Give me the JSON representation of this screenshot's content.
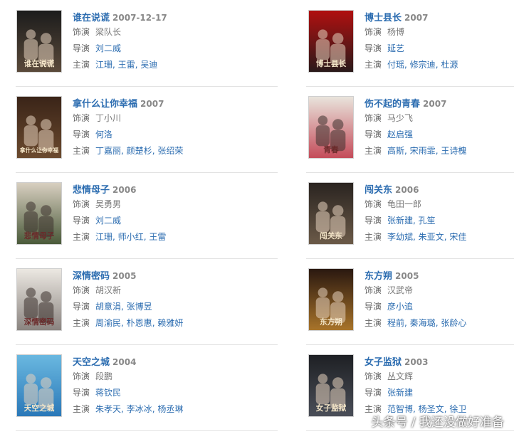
{
  "labels": {
    "role": "饰演",
    "director": "导演",
    "cast": "主演"
  },
  "movies": [
    {
      "title": "谁在说谎",
      "year": "2007-12-17",
      "role": "梁队长",
      "director": [
        "刘二威"
      ],
      "cast": [
        "江珊",
        "王雷",
        "吴迪"
      ],
      "poster_text": "谁在说谎",
      "colors": [
        "#1c1c1c",
        "#5a4a3a"
      ]
    },
    {
      "title": "博士县长",
      "year": "2007",
      "role": "杨博",
      "director": [
        "延艺"
      ],
      "cast": [
        "付瑶",
        "修宗迪",
        "杜源"
      ],
      "poster_text": "博士县长",
      "colors": [
        "#b01010",
        "#2a1a1a"
      ]
    },
    {
      "title": "拿什么让你幸福",
      "year": "2007",
      "role": "丁小川",
      "director": [
        "何洛"
      ],
      "cast": [
        "丁嘉丽",
        "颜楚杉",
        "张绍荣"
      ],
      "poster_text": "拿什么让你幸福",
      "colors": [
        "#3a2418",
        "#6b4a2e"
      ]
    },
    {
      "title": "伤不起的青春",
      "year": "2007",
      "role": "马少飞",
      "director": [
        "赵启强"
      ],
      "cast": [
        "高斯",
        "宋雨霏",
        "王诗槐"
      ],
      "poster_text": "青春",
      "colors": [
        "#e9e4dc",
        "#c44c5a"
      ]
    },
    {
      "title": "悲情母子",
      "year": "2006",
      "role": "吴勇男",
      "director": [
        "刘二威"
      ],
      "cast": [
        "江珊",
        "师小红",
        "王雷"
      ],
      "poster_text": "悲情母子",
      "colors": [
        "#d8cfc0",
        "#4a5a3a"
      ]
    },
    {
      "title": "闯关东",
      "year": "2006",
      "role": "龟田一郎",
      "director": [
        "张新建",
        "孔笙"
      ],
      "cast": [
        "李幼斌",
        "朱亚文",
        "宋佳"
      ],
      "poster_text": "闯关东",
      "colors": [
        "#2a2420",
        "#6b5a48"
      ]
    },
    {
      "title": "深情密码",
      "year": "2005",
      "role": "胡汉新",
      "director": [
        "胡意涓",
        "张博昱"
      ],
      "cast": [
        "周渝民",
        "朴恩惠",
        "赖雅妍"
      ],
      "poster_text": "深情密码",
      "colors": [
        "#ece8e2",
        "#8a8480"
      ]
    },
    {
      "title": "东方朔",
      "year": "2005",
      "role": "汉武帝",
      "director": [
        "彦小追"
      ],
      "cast": [
        "程前",
        "秦海璐",
        "张龄心"
      ],
      "poster_text": "东方朔",
      "colors": [
        "#2a1810",
        "#a8742a"
      ]
    },
    {
      "title": "天空之城",
      "year": "2004",
      "role": "段鹏",
      "director": [
        "蒋钦民"
      ],
      "cast": [
        "朱孝天",
        "李冰冰",
        "杨丞琳"
      ],
      "poster_text": "天空之城",
      "colors": [
        "#6ab8e0",
        "#2a78b8"
      ]
    },
    {
      "title": "女子监狱",
      "year": "2003",
      "role": "丛文辉",
      "director": [
        "张新建"
      ],
      "cast": [
        "范智博",
        "杨圣文",
        "徐卫"
      ],
      "poster_text": "女子监狱",
      "colors": [
        "#1e2024",
        "#4a4e58"
      ]
    }
  ],
  "watermark": "头条号 / 我还没做好准备"
}
